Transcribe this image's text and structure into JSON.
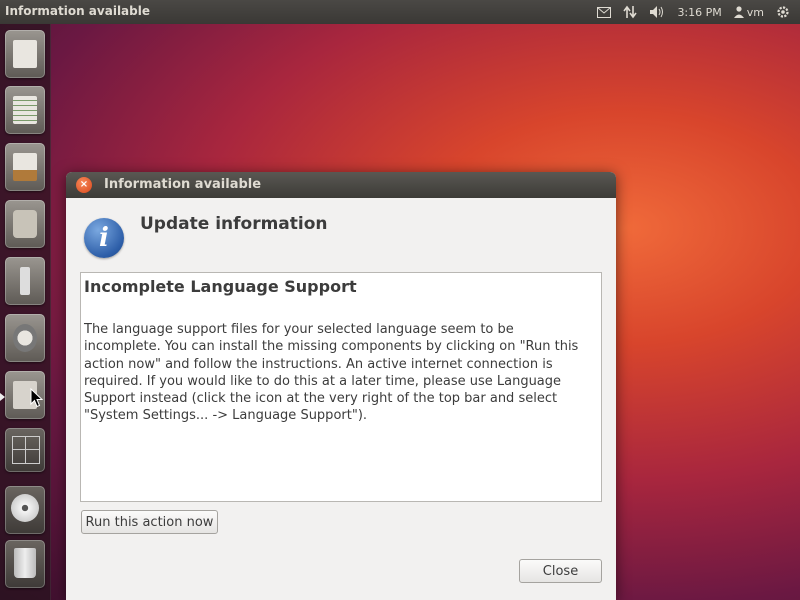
{
  "top_panel": {
    "app_title": "Information available",
    "time": "3:16 PM",
    "user": "vm"
  },
  "launcher": {
    "items": [
      {
        "name": "libreoffice-writer"
      },
      {
        "name": "libreoffice-calc"
      },
      {
        "name": "libreoffice-impress"
      },
      {
        "name": "software-center"
      },
      {
        "name": "ubuntu-one"
      },
      {
        "name": "system-settings"
      },
      {
        "name": "active-app"
      },
      {
        "name": "workspace-switcher"
      },
      {
        "name": "optical-drive"
      },
      {
        "name": "trash"
      }
    ]
  },
  "dialog": {
    "title": "Information available",
    "heading": "Update information",
    "message_title": "Incomplete Language Support",
    "message_body": "The language support files for your selected language seem to be incomplete. You can install the missing components by clicking on \"Run this action now\" and follow the instructions. An active internet connection is required. If you would like to do this at a later time, please use Language Support instead (click the icon at the very right of the top bar and select \"System Settings... -> Language Support\").",
    "run_button": "Run this action now",
    "close_button": "Close"
  }
}
